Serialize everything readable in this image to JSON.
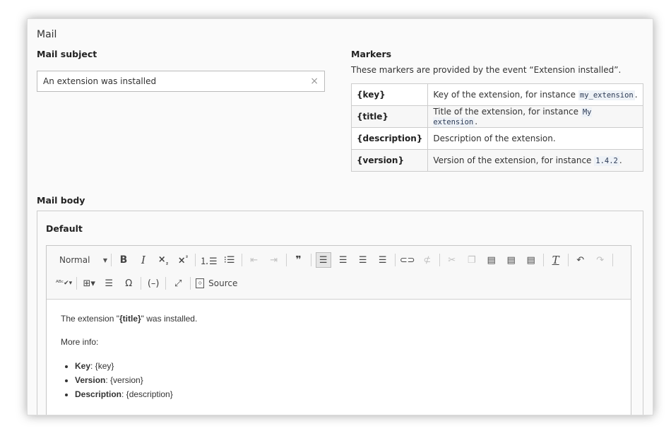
{
  "panel": {
    "title": "Mail"
  },
  "subject": {
    "label": "Mail subject",
    "value": "An extension was installed",
    "clear_icon": "×"
  },
  "markers": {
    "title": "Markers",
    "description": "These markers are provided by the event “Extension installed”.",
    "rows": [
      {
        "key": "{key}",
        "text": "Key of the extension, for instance ",
        "code": "my_extension",
        "suffix": "."
      },
      {
        "key": "{title}",
        "text": "Title of the extension, for instance ",
        "code": "My extension",
        "suffix": "."
      },
      {
        "key": "{description}",
        "text": "Description of the extension.",
        "code": "",
        "suffix": ""
      },
      {
        "key": "{version}",
        "text": "Version of the extension, for instance ",
        "code": "1.4.2",
        "suffix": "."
      }
    ]
  },
  "body": {
    "label": "Mail body",
    "section": "Default",
    "toolbar": {
      "format": "Normal",
      "bold": "B",
      "italic": "I",
      "source_label": "Source"
    },
    "content": {
      "line1_pre": "The extension \"",
      "line1_bold": "{title}",
      "line1_post": "\" was installed.",
      "line2": "More info:",
      "items": [
        {
          "label": "Key",
          "value": ": {key}"
        },
        {
          "label": "Version",
          "value": ": {version}"
        },
        {
          "label": "Description",
          "value": ": {description}"
        }
      ]
    }
  }
}
